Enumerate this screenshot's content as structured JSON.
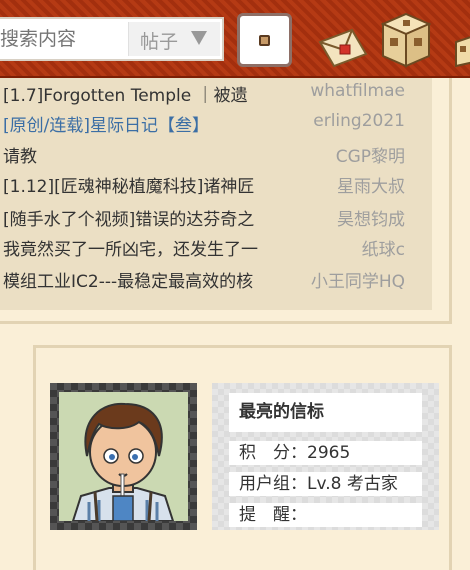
{
  "header": {
    "search_placeholder": "搜索内容",
    "search_scope": "帖子"
  },
  "threads": [
    {
      "title": "[1.7]Forgotten Temple ｜被遗",
      "author": "whatfilmae",
      "highlight": false
    },
    {
      "title": "[原创/连载]星际日记【叁】",
      "author": "erling2021",
      "highlight": true
    },
    {
      "title": "请教",
      "author": "CGP黎明",
      "highlight": false
    },
    {
      "title": "[1.12][匠魂神秘植魔科技]诸神匠",
      "author": "星雨大叔",
      "highlight": false
    },
    {
      "title": "[随手水了个视频]错误的达芬奇之",
      "author": "昊想钧成",
      "highlight": false
    },
    {
      "title": "我竟然买了一所凶宅，还发生了一",
      "author": "纸球c",
      "highlight": false
    },
    {
      "title": "模组工业IC2---最稳定最高效的核",
      "author": "小王同学HQ",
      "highlight": false
    }
  ],
  "profile": {
    "name": "最亮的信标",
    "points_label": "积　分：",
    "points_value": "2965",
    "group_label": "用户组：",
    "group_value": "Lv.8 考古家",
    "remind_label": "提　醒："
  },
  "colors": {
    "header_bg": "#b53a14",
    "page_bg": "#faefd7",
    "panel_bg": "#ebdfc4",
    "link_blue": "#3b6ea5",
    "author_gray": "#9e9e9e"
  },
  "icons": [
    "envelope-icon",
    "box-icon",
    "user-avatar-icon"
  ]
}
